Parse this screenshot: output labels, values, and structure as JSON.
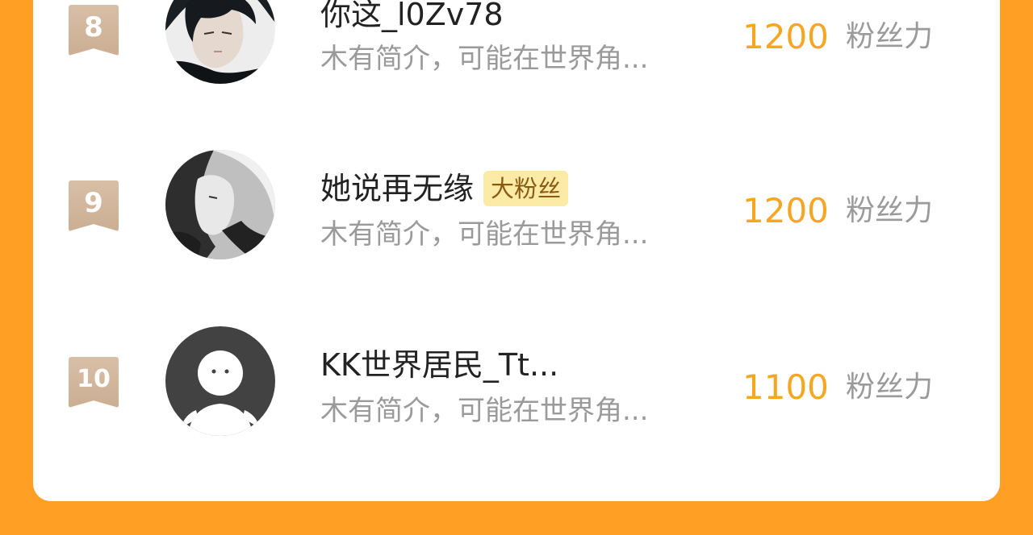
{
  "leaderboard": {
    "rows": [
      {
        "rank": "8",
        "username": "你这_l0Zv78",
        "tag": "",
        "bio": "木有简介，可能在世界角...",
        "score": "1200",
        "score_unit": "粉丝力",
        "avatar": "dark-haired-character-avatar"
      },
      {
        "rank": "9",
        "username": "她说再无缘",
        "tag": "大粉丝",
        "bio": "木有简介，可能在世界角...",
        "score": "1200",
        "score_unit": "粉丝力",
        "avatar": "monochrome-sketch-avatar"
      },
      {
        "rank": "10",
        "username": "KK世界居民_Tt...",
        "tag": "",
        "bio": "木有简介，可能在世界角...",
        "score": "1100",
        "score_unit": "粉丝力",
        "avatar": "default-person-avatar"
      }
    ]
  },
  "colors": {
    "page_background": "#FF9F24",
    "card_background": "#FFFFFF",
    "rank_badge": "#D2B79C",
    "score": "#F5A623",
    "tag_background": "#FCEBA6",
    "muted_text": "#9A9A9A"
  }
}
